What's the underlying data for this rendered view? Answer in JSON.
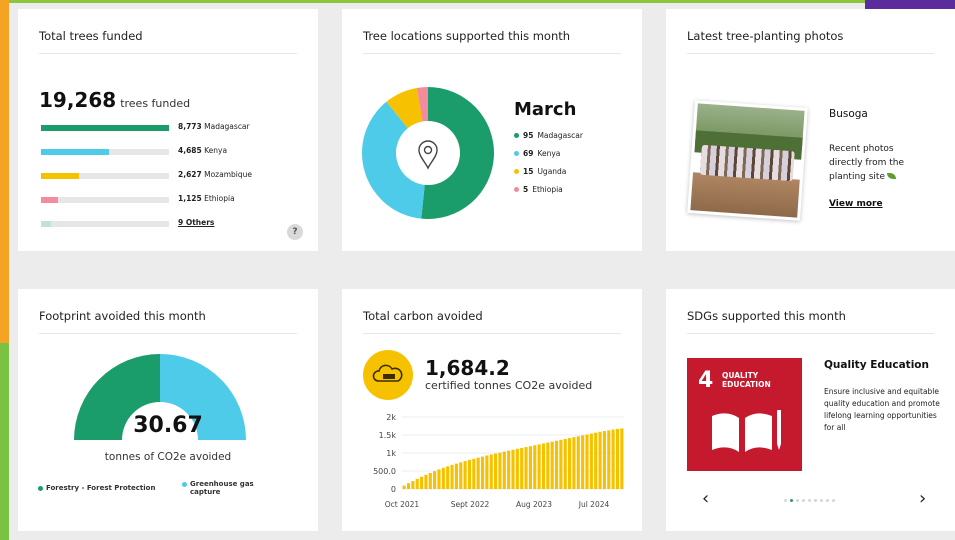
{
  "colors": {
    "green": "#1a9c6b",
    "cyan": "#4dcbe8",
    "yellow": "#f6c200",
    "pink": "#f28b9b",
    "sdg_red": "#c5192d",
    "accent_purple": "#5b2c9b"
  },
  "trees": {
    "title": "Total trees funded",
    "total": "19,268",
    "total_suffix": "trees funded",
    "rows": [
      {
        "value": "8,773",
        "country": "Madagascar",
        "fraction": 1.0,
        "color": "#1a9c6b"
      },
      {
        "value": "4,685",
        "country": "Kenya",
        "fraction": 0.53,
        "color": "#4dcbe8"
      },
      {
        "value": "2,627",
        "country": "Mozambique",
        "fraction": 0.3,
        "color": "#f6c200"
      },
      {
        "value": "1,125",
        "country": "Ethiopia",
        "fraction": 0.13,
        "color": "#f28b9b"
      },
      {
        "value": "9 Others",
        "country": "",
        "fraction": 0.08,
        "color": "#bfe4d4"
      }
    ],
    "help_icon": "question-icon",
    "help_label": "?"
  },
  "locations": {
    "title": "Tree locations supported this month",
    "month": "March",
    "icon": "map-pin-icon",
    "items": [
      {
        "value": "95",
        "country": "Madagascar",
        "count": 95,
        "color": "#1a9c6b"
      },
      {
        "value": "69",
        "country": "Kenya",
        "count": 69,
        "color": "#4dcbe8"
      },
      {
        "value": "15",
        "country": "Uganda",
        "count": 15,
        "color": "#f6c200"
      },
      {
        "value": "5",
        "country": "Ethiopia",
        "count": 5,
        "color": "#f28b9b"
      }
    ]
  },
  "photos": {
    "title": "Latest tree-planting photos",
    "location": "Busoga",
    "text": "Recent photos directly from the planting site",
    "icon": "leaf-icon",
    "link": "View more"
  },
  "footprint": {
    "title": "Footprint avoided this month",
    "value": "30.67",
    "unit": "tonnes of CO2e avoided",
    "legend": [
      {
        "label": "Forestry - Forest Protection",
        "color": "#1a9c6b",
        "fraction": 0.5
      },
      {
        "label": "Greenhouse gas capture",
        "color": "#4dcbe8",
        "fraction": 0.5
      }
    ]
  },
  "carbon": {
    "title": "Total carbon avoided",
    "badge_icon": "cloud-co2-icon",
    "value": "1,684.2",
    "subtitle": "certified tonnes CO2e avoided"
  },
  "chart_data": {
    "type": "bar",
    "title": "",
    "xlabel": "",
    "ylabel": "",
    "ylim": [
      0,
      2000
    ],
    "y_ticks": [
      "0",
      "500.0",
      "1k",
      "1.5k",
      "2k"
    ],
    "x_ticks": [
      "Oct 2021",
      "Sept 2022",
      "Aug 2023",
      "Jul 2024"
    ],
    "color": "#f6c200",
    "values": [
      95,
      160,
      220,
      280,
      340,
      395,
      445,
      495,
      545,
      590,
      630,
      670,
      705,
      740,
      775,
      810,
      840,
      870,
      900,
      930,
      960,
      985,
      1010,
      1040,
      1065,
      1090,
      1115,
      1140,
      1165,
      1190,
      1215,
      1240,
      1265,
      1290,
      1315,
      1340,
      1365,
      1390,
      1415,
      1440,
      1465,
      1490,
      1515,
      1540,
      1565,
      1590,
      1610,
      1630,
      1650,
      1670,
      1684
    ]
  },
  "sdg": {
    "title": "SDGs supported this month",
    "number": "4",
    "tile_label": "QUALITY EDUCATION",
    "tile_icon": "book-pencil-icon",
    "name": "Quality Education",
    "description": "Ensure inclusive and equitable quality education and promote lifelong learning opportunities for all",
    "prev": "‹",
    "next": "›",
    "pages": 9,
    "active_page": 1
  }
}
